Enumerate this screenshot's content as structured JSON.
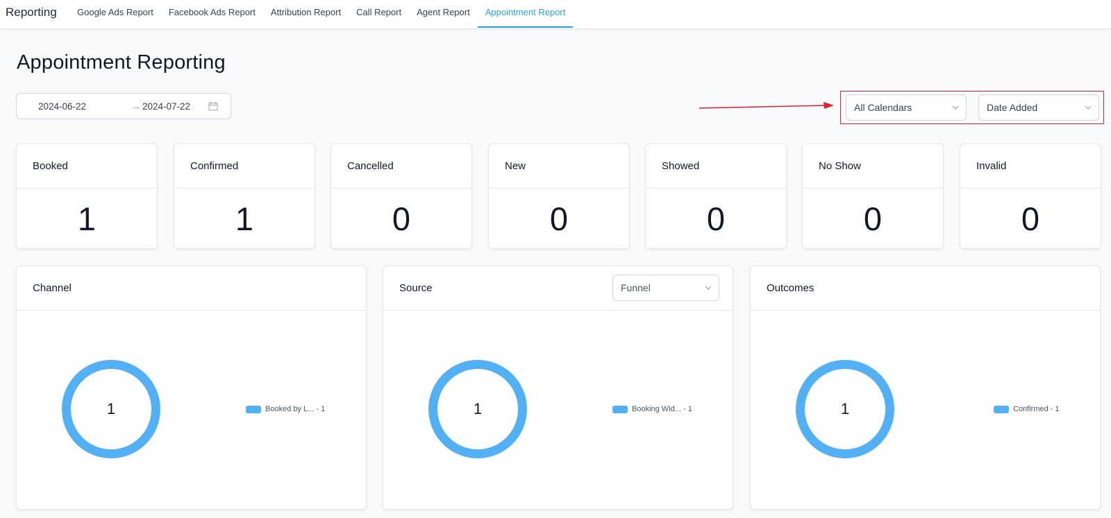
{
  "nav": {
    "brand": "Reporting",
    "tabs": [
      {
        "label": "Google Ads Report"
      },
      {
        "label": "Facebook Ads Report"
      },
      {
        "label": "Attribution Report"
      },
      {
        "label": "Call Report"
      },
      {
        "label": "Agent Report"
      },
      {
        "label": "Appointment Report",
        "active": true
      }
    ]
  },
  "page": {
    "title": "Appointment Reporting"
  },
  "date_range": {
    "start": "2024-06-22",
    "end": "2024-07-22",
    "arrow_icon": "arrow-right-icon",
    "calendar_icon": "calendar-icon"
  },
  "filters": {
    "calendar_select": "All Calendars",
    "date_type_select": "Date Added"
  },
  "stats": [
    {
      "label": "Booked",
      "value": "1"
    },
    {
      "label": "Confirmed",
      "value": "1"
    },
    {
      "label": "Cancelled",
      "value": "0"
    },
    {
      "label": "New",
      "value": "0"
    },
    {
      "label": "Showed",
      "value": "0"
    },
    {
      "label": "No Show",
      "value": "0"
    },
    {
      "label": "Invalid",
      "value": "0"
    }
  ],
  "panels": [
    {
      "title": "Channel",
      "center": "1",
      "legend": "Booked by L... - 1"
    },
    {
      "title": "Source",
      "center": "1",
      "legend": "Booking Wid... - 1",
      "select": "Funnel"
    },
    {
      "title": "Outcomes",
      "center": "1",
      "legend": "Confirmed - 1"
    }
  ],
  "colors": {
    "accent": "#2aa0e0",
    "donut": "#54b0f5",
    "annotation": "#e11d2e"
  },
  "chart_data": [
    {
      "type": "pie",
      "title": "Channel",
      "categories": [
        "Booked by L..."
      ],
      "values": [
        1
      ]
    },
    {
      "type": "pie",
      "title": "Source",
      "categories": [
        "Booking Wid..."
      ],
      "values": [
        1
      ]
    },
    {
      "type": "pie",
      "title": "Outcomes",
      "categories": [
        "Confirmed"
      ],
      "values": [
        1
      ]
    }
  ]
}
